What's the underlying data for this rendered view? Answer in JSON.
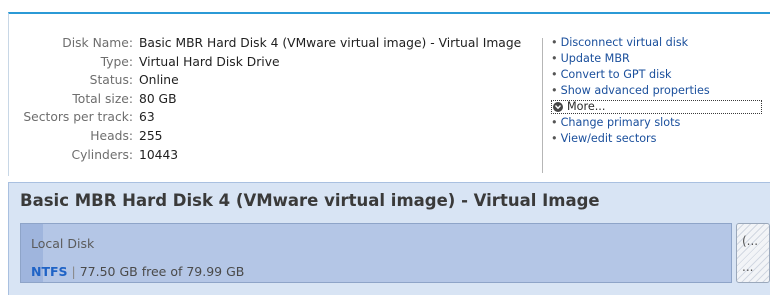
{
  "properties": [
    {
      "key": "Disk Name:",
      "value": "Basic MBR Hard Disk 4 (VMware virtual image) - Virtual Image"
    },
    {
      "key": "Type:",
      "value": "Virtual Hard Disk Drive"
    },
    {
      "key": "Status:",
      "value": "Online"
    },
    {
      "key": "Total size:",
      "value": "80 GB"
    },
    {
      "key": "Sectors per track:",
      "value": "63"
    },
    {
      "key": "Heads:",
      "value": "255"
    },
    {
      "key": "Cylinders:",
      "value": "10443"
    }
  ],
  "actions": {
    "bullet": "•",
    "disconnect": "Disconnect virtual disk",
    "update_mbr": "Update MBR",
    "convert_gpt": "Convert to GPT disk",
    "show_advanced": "Show advanced properties",
    "more": "More...",
    "change_slots": "Change primary slots",
    "view_sectors": "View/edit sectors"
  },
  "disk": {
    "title": "Basic MBR Hard Disk 4 (VMware virtual image) - Virtual Image",
    "partition": {
      "name": "Local Disk",
      "filesystem": "NTFS",
      "separator": " | ",
      "free_text": "77.50 GB free of 79.99 GB",
      "used_fraction": 0.031
    },
    "unallocated": {
      "top_text": "(...",
      "bottom_text": "..."
    }
  },
  "colors": {
    "accent": "#2b9ad6",
    "link": "#1a4f9c",
    "filesystem": "#1f63c6",
    "disk_panel": "#d8e4f4",
    "partition": "#b4c6e6"
  }
}
